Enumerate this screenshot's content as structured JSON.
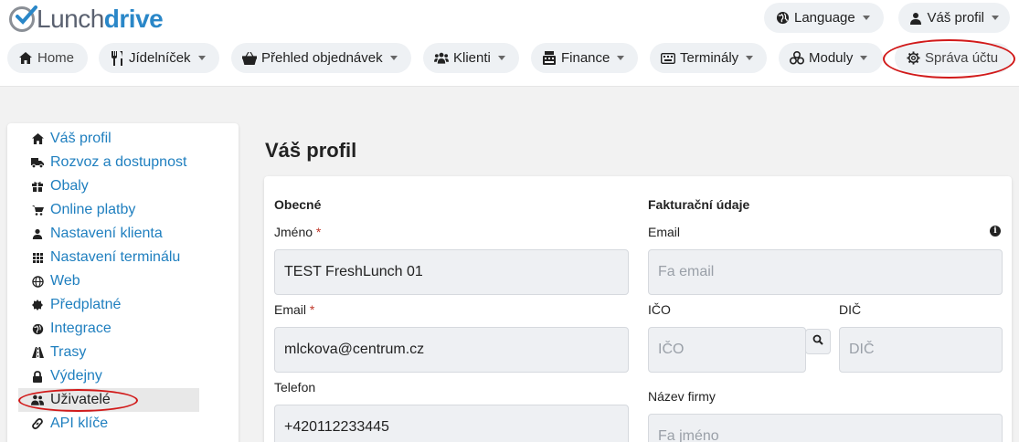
{
  "brand": {
    "name_part1": "Lunch",
    "name_part2": "drive"
  },
  "top_right": {
    "language_label": "Language",
    "profile_label": "Váš profil"
  },
  "nav": {
    "home": "Home",
    "menu": "Jídelníček",
    "orders": "Přehled objednávek",
    "clients": "Klienti",
    "finance": "Finance",
    "terminals": "Terminály",
    "modules": "Moduly",
    "account": "Správa účtu"
  },
  "sidebar": {
    "items": [
      {
        "label": "Váš profil",
        "icon": "home-icon"
      },
      {
        "label": "Rozvoz a dostupnost",
        "icon": "truck-icon"
      },
      {
        "label": "Obaly",
        "icon": "gift-icon"
      },
      {
        "label": "Online platby",
        "icon": "cart-icon"
      },
      {
        "label": "Nastavení klienta",
        "icon": "user-icon"
      },
      {
        "label": "Nastavení terminálu",
        "icon": "grid-icon"
      },
      {
        "label": "Web",
        "icon": "globe-icon"
      },
      {
        "label": "Předplatné",
        "icon": "badge-icon"
      },
      {
        "label": "Integrace",
        "icon": "globe-solid-icon"
      },
      {
        "label": "Trasy",
        "icon": "road-icon"
      },
      {
        "label": "Výdejny",
        "icon": "lock-icon"
      },
      {
        "label": "Uživatelé",
        "icon": "users-icon"
      },
      {
        "label": "API klíče",
        "icon": "link-icon"
      }
    ],
    "active_index": 11
  },
  "page": {
    "title": "Váš profil"
  },
  "general": {
    "heading": "Obecné",
    "name_label": "Jméno",
    "name_value": "TEST FreshLunch 01",
    "email_label": "Email",
    "email_value": "mlckova@centrum.cz",
    "phone_label": "Telefon",
    "phone_value": "+420112233445",
    "required_mark": "*"
  },
  "billing": {
    "heading": "Fakturační údaje",
    "email_label": "Email",
    "email_placeholder": "Fa email",
    "ico_label": "IČO",
    "ico_placeholder": "IČO",
    "dic_label": "DIČ",
    "dic_placeholder": "DIČ",
    "company_label": "Název firmy",
    "company_placeholder": "Fa jméno",
    "info_glyph": "i"
  },
  "colors": {
    "link": "#1f7fbf",
    "brand_blue": "#2a87c8",
    "annotation": "#d11a1a"
  }
}
